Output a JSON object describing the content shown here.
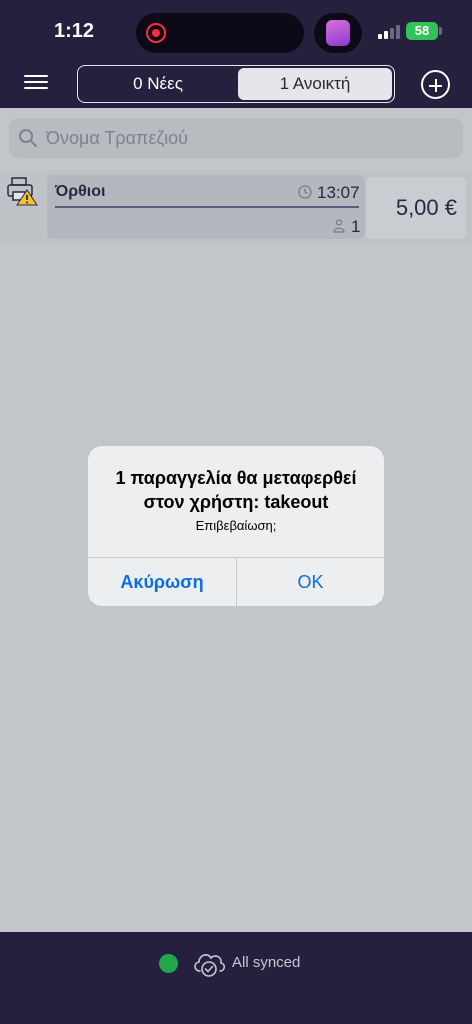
{
  "status_bar": {
    "time": "1:12",
    "battery": "58"
  },
  "nav": {
    "tab_new": "0 Νέες",
    "tab_open": "1 Ανοικτή"
  },
  "search": {
    "placeholder": "Όνομα Τραπεζιού",
    "value": ""
  },
  "orders": [
    {
      "name": "Όρθιοι",
      "time": "13:07",
      "guests": "1",
      "amount": "5,00 €"
    }
  ],
  "alert": {
    "title": "1 παραγγελία θα μεταφερθεί στον χρήστη: takeout",
    "message": "Επιβεβαίωση;",
    "cancel_label": "Ακύρωση",
    "ok_label": "OK"
  },
  "footer": {
    "sync_status": "All synced"
  },
  "colors": {
    "header_bg": "#261f3d",
    "sync_dot": "#22a84a",
    "alert_button": "#0a6fe6",
    "warning": "#f2c230"
  }
}
